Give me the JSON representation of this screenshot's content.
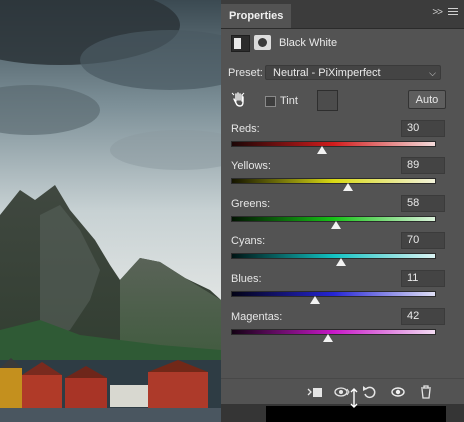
{
  "panel": {
    "tab_title": "Properties",
    "collapse_glyph": ">>",
    "adjustment_title": "Black  White"
  },
  "preset": {
    "label": "Preset:",
    "value": "Neutral - PiXimperfect"
  },
  "tint": {
    "label": "Tint",
    "checked": false,
    "auto_label": "Auto"
  },
  "sliders": [
    {
      "label": "Reds:",
      "value": "30",
      "level": 0.45,
      "gradient": [
        "#1b0606",
        "#d21c1c",
        "#f4dcdc"
      ]
    },
    {
      "label": "Yellows:",
      "value": "89",
      "level": 0.575,
      "gradient": [
        "#141400",
        "#d9d914",
        "#f3f3dc"
      ]
    },
    {
      "label": "Greens:",
      "value": "58",
      "level": 0.515,
      "gradient": [
        "#021402",
        "#17c217",
        "#dcf3dc"
      ]
    },
    {
      "label": "Cyans:",
      "value": "70",
      "level": 0.54,
      "gradient": [
        "#001414",
        "#12c2c2",
        "#dcf3f3"
      ]
    },
    {
      "label": "Blues:",
      "value": "11",
      "level": 0.415,
      "gradient": [
        "#020214",
        "#2525d4",
        "#e0e0f6"
      ]
    },
    {
      "label": "Magentas:",
      "value": "42",
      "level": 0.48,
      "gradient": [
        "#140214",
        "#c818c8",
        "#f3dcf3"
      ]
    }
  ],
  "colors": {
    "panel_bg": "#535353",
    "tab_bar_bg": "#3c3c3c",
    "input_bg": "#444444"
  },
  "icons": [
    "adjustment-layer-icon",
    "mask-icon",
    "targeted-adjustment-hand-icon",
    "panel-menu-icon",
    "clip-to-layer-icon",
    "view-previous-state-icon",
    "reset-icon",
    "visibility-icon",
    "delete-icon"
  ]
}
